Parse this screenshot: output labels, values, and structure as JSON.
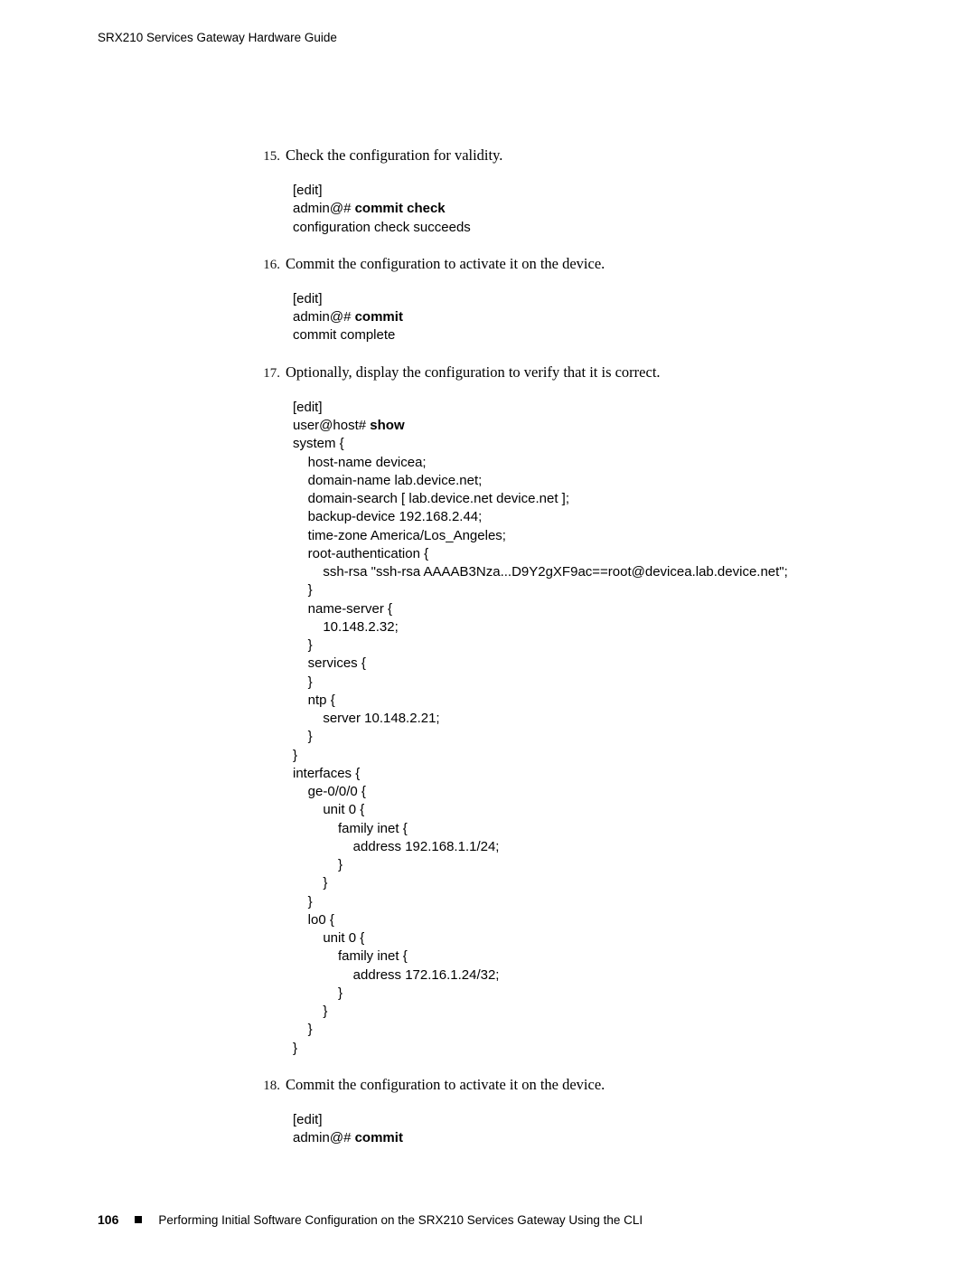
{
  "header": {
    "title": "SRX210 Services Gateway Hardware Guide"
  },
  "steps": [
    {
      "num": "15.",
      "text": "Check the configuration for validity.",
      "code_html": "[edit]\nadmin@# <span class=\"b\">commit check</span>\nconfiguration check succeeds"
    },
    {
      "num": "16.",
      "text": "Commit the configuration to activate it on the device.",
      "code_html": "[edit]\nadmin@# <span class=\"b\">commit</span>\ncommit complete"
    },
    {
      "num": "17.",
      "text": "Optionally, display the configuration to verify that it is correct.",
      "code_html": "[edit]\nuser@host# <span class=\"b\">show</span>\nsystem {\n    host-name devicea;\n    domain-name lab.device.net;\n    domain-search [ lab.device.net device.net ];\n    backup-device 192.168.2.44;\n    time-zone America/Los_Angeles;\n    root-authentication {\n        ssh-rsa \"ssh-rsa AAAAB3Nza...D9Y2gXF9ac==root@devicea.lab.device.net\";\n    }\n    name-server {\n        10.148.2.32;\n    }\n    services {\n    }\n    ntp {\n        server 10.148.2.21;\n    }\n}\ninterfaces {\n    ge-0/0/0 {\n        unit 0 {\n            family inet {\n                address 192.168.1.1/24;\n            }\n        }\n    }\n    lo0 {\n        unit 0 {\n            family inet {\n                address 172.16.1.24/32;\n            }\n        }\n    }\n}"
    },
    {
      "num": "18.",
      "text": "Commit the configuration to activate it on the device.",
      "code_html": "[edit]\nadmin@# <span class=\"b\">commit</span>"
    }
  ],
  "footer": {
    "page_number": "106",
    "section_title": "Performing Initial Software Configuration on the SRX210 Services Gateway Using the CLI"
  }
}
